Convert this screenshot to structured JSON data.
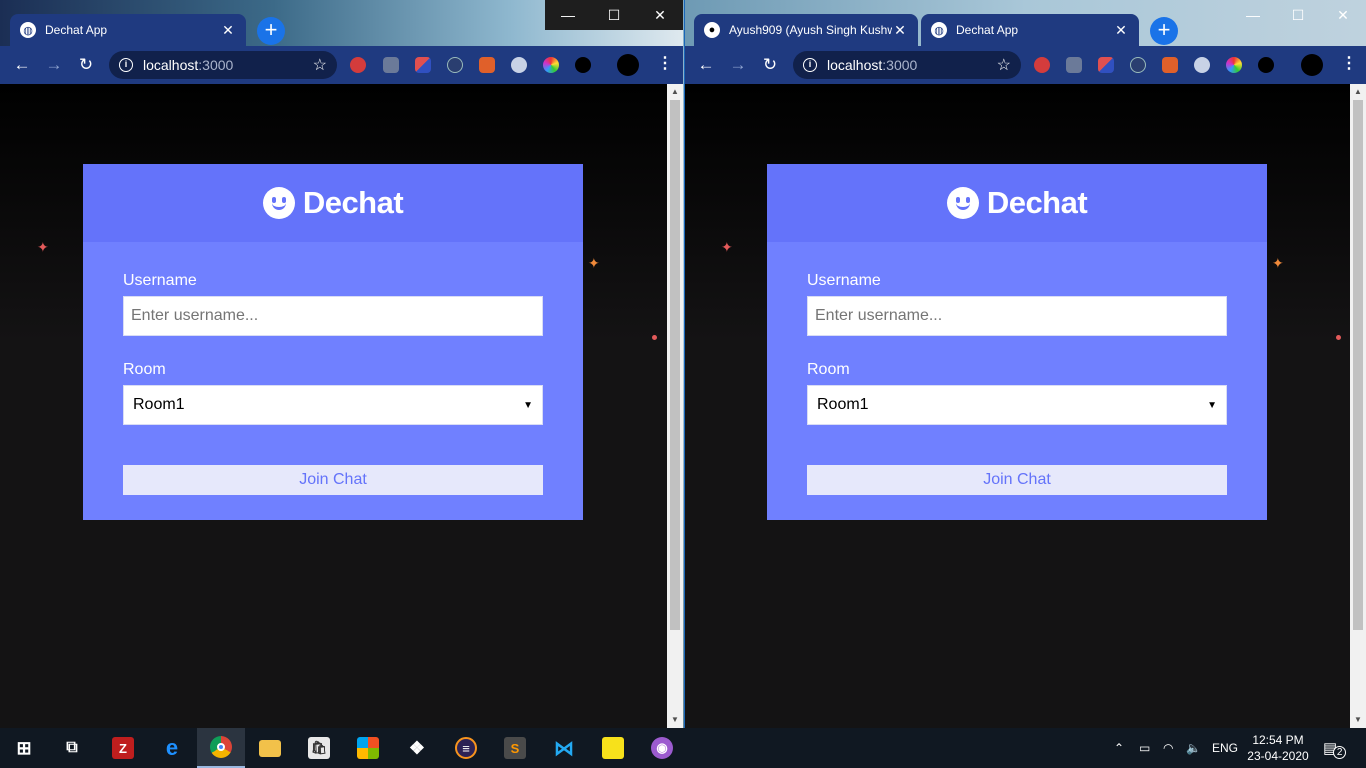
{
  "windows": [
    {
      "tabs": [
        {
          "title": "Dechat App",
          "active": true
        }
      ],
      "address": {
        "host": "localhost",
        "port": ":3000"
      }
    },
    {
      "tabs": [
        {
          "title": "Ayush909 (Ayush Singh Kushw",
          "active": false
        },
        {
          "title": "Dechat App",
          "active": true
        }
      ],
      "address": {
        "host": "localhost",
        "port": ":3000"
      }
    }
  ],
  "app": {
    "brand": "Dechat",
    "username_label": "Username",
    "username_placeholder": "Enter username...",
    "room_label": "Room",
    "room_selected": "Room1",
    "join_label": "Join Chat"
  },
  "colors": {
    "card": "#7080ff",
    "card_header": "#6473fa",
    "chrome_frame": "#1f3a80",
    "page_bg": "#141314"
  },
  "taskbar": {
    "apps": [
      "windows-start-icon",
      "task-view-icon",
      "filezilla-icon",
      "edge-icon",
      "chrome-icon",
      "file-explorer-icon",
      "store-icon",
      "app-icon",
      "dropbox-icon",
      "eclipse-icon",
      "sublime-icon",
      "vscode-icon",
      "sticky-notes-icon",
      "github-desktop-icon"
    ],
    "language": "ENG",
    "time": "12:54 PM",
    "date": "23-04-2020",
    "notifications": "2"
  }
}
